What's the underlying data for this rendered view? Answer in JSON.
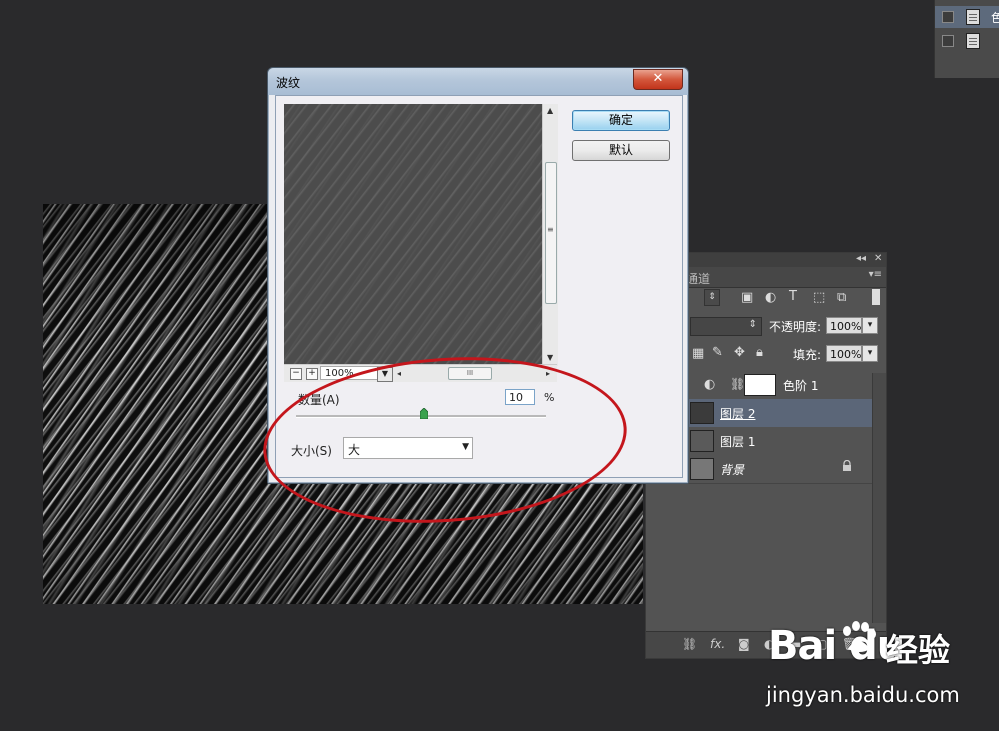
{
  "top_right_panel": {
    "rows": [
      {
        "label": "色"
      },
      {
        "label": ""
      }
    ]
  },
  "dialog": {
    "title": "波纹",
    "close_symbol": "✕",
    "ok_label": "确定",
    "default_label": "默认",
    "zoom_value": "100%",
    "amount_label": "数量(A)",
    "amount_value": "10",
    "amount_unit": "%",
    "amount_level_fraction": 0.51,
    "size_label": "大小(S)",
    "size_value": "大"
  },
  "layers_panel": {
    "channels_tab": "通道",
    "opacity_label": "不透明度:",
    "opacity_value": "100%",
    "fill_label": "填充:",
    "fill_value": "100%",
    "layers": [
      {
        "name": "色阶 1",
        "selected": false
      },
      {
        "name": "图层 2",
        "selected": true
      },
      {
        "name": "图层 1",
        "selected": false
      },
      {
        "name": "背景",
        "selected": false
      }
    ],
    "bottom_icons": [
      "link-icon",
      "fx-icon",
      "mask-icon",
      "adjustment-icon",
      "folder-icon",
      "new-layer-icon",
      "trash-icon"
    ],
    "fx_label": "fx."
  },
  "watermark": {
    "logo": "Bai du",
    "brand": "经验",
    "url": "jingyan.baidu.com"
  },
  "colors": {
    "annotation": "#c4161c",
    "ok_button": "#98d1ef",
    "selected_layer": "#5b6678"
  }
}
